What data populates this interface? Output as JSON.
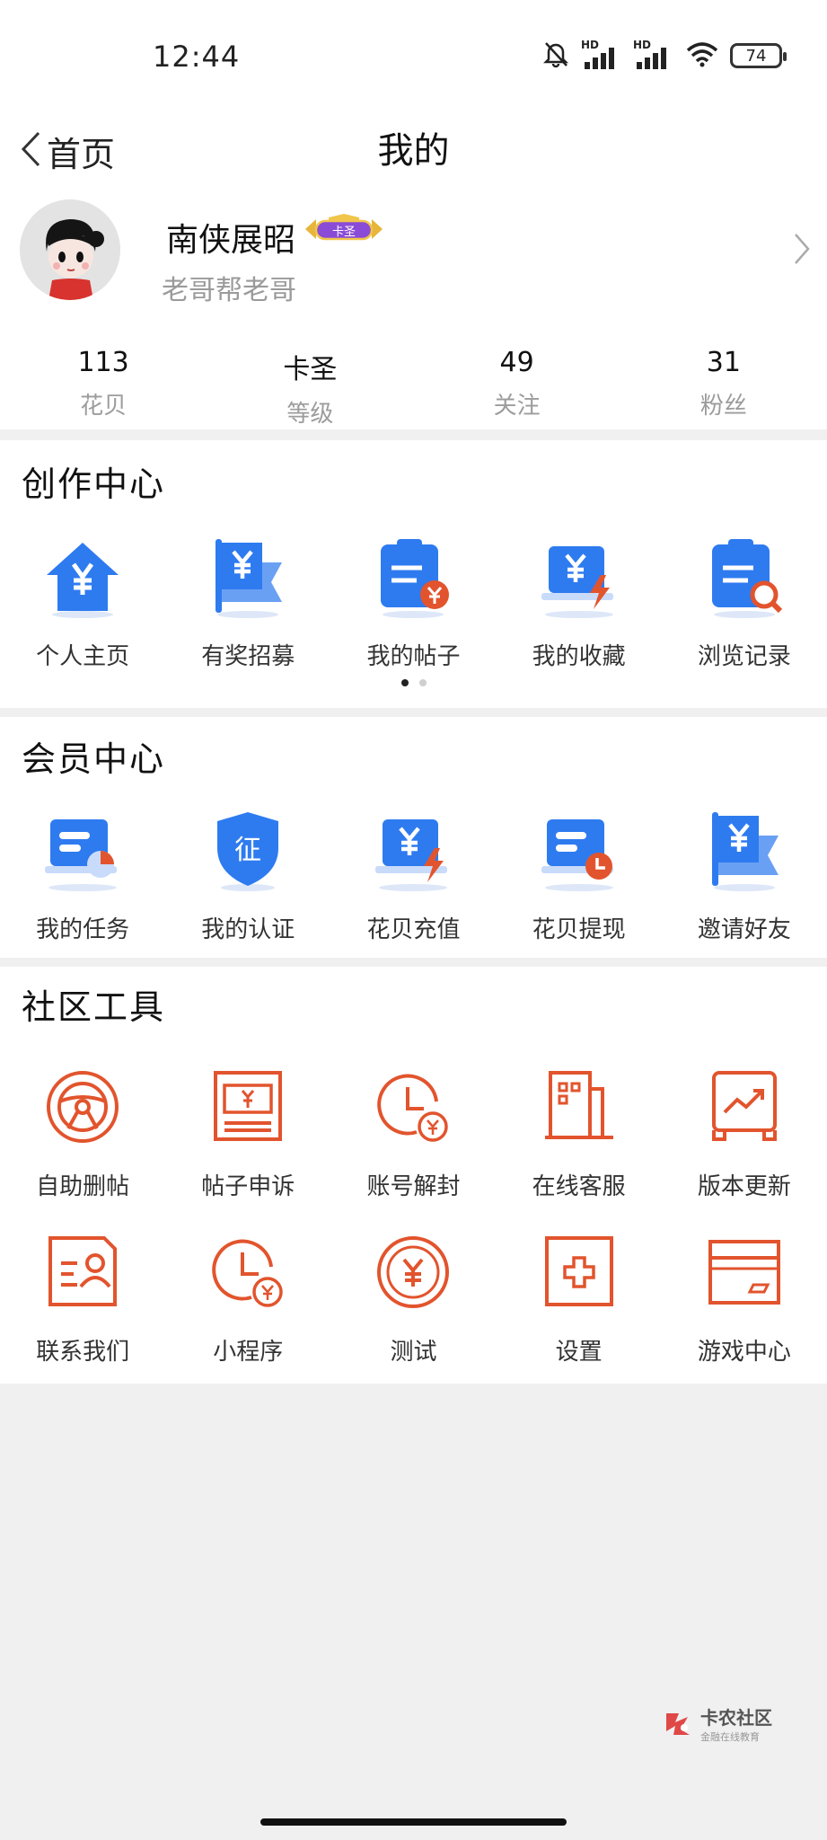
{
  "status": {
    "time": "12:44",
    "battery": "74",
    "sim_label": "HD"
  },
  "header": {
    "back_label": "首页",
    "title": "我的"
  },
  "profile": {
    "name": "南侠展昭",
    "badge": "卡圣",
    "signature": "老哥帮老哥"
  },
  "stats": [
    {
      "value": "113",
      "label": "花贝"
    },
    {
      "value": "卡圣",
      "label": "等级"
    },
    {
      "value": "49",
      "label": "关注"
    },
    {
      "value": "31",
      "label": "粉丝"
    }
  ],
  "creation": {
    "title": "创作中心",
    "items": [
      {
        "label": "个人主页",
        "icon": "home-yen-icon"
      },
      {
        "label": "有奖招募",
        "icon": "flag-yen-icon"
      },
      {
        "label": "我的帖子",
        "icon": "clipboard-yen-icon"
      },
      {
        "label": "我的收藏",
        "icon": "laptop-yen-icon"
      },
      {
        "label": "浏览记录",
        "icon": "clipboard-search-icon"
      }
    ],
    "page_dots": {
      "count": 2,
      "active": 0
    }
  },
  "member": {
    "title": "会员中心",
    "items": [
      {
        "label": "我的任务",
        "icon": "task-icon"
      },
      {
        "label": "我的认证",
        "icon": "shield-verify-icon"
      },
      {
        "label": "花贝充值",
        "icon": "laptop-yen-icon"
      },
      {
        "label": "花贝提现",
        "icon": "laptop-clock-icon"
      },
      {
        "label": "邀请好友",
        "icon": "flag-yen-icon"
      }
    ]
  },
  "tools": {
    "title": "社区工具",
    "items": [
      {
        "label": "自助删帖",
        "icon": "steering-wheel-icon"
      },
      {
        "label": "帖子申诉",
        "icon": "banknote-icon"
      },
      {
        "label": "账号解封",
        "icon": "clock-yen-icon"
      },
      {
        "label": "在线客服",
        "icon": "building-icon"
      },
      {
        "label": "版本更新",
        "icon": "chart-monitor-icon"
      },
      {
        "label": "联系我们",
        "icon": "contact-card-icon"
      },
      {
        "label": "小程序",
        "icon": "clock-yen-icon"
      },
      {
        "label": "测试",
        "icon": "coin-yen-icon"
      },
      {
        "label": "设置",
        "icon": "plus-box-icon"
      },
      {
        "label": "游戏中心",
        "icon": "card-icon"
      }
    ]
  },
  "watermark": {
    "title": "卡农社区",
    "subtitle": "金融在线教育"
  },
  "colors": {
    "blue": "#2e7bf0",
    "orange": "#e2542d",
    "text": "#111111",
    "muted": "#9a9a9a",
    "background": "#f0f0f0"
  }
}
